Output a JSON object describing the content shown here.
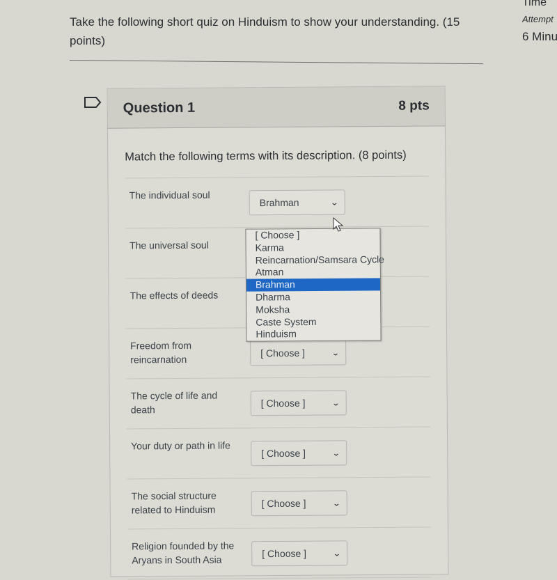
{
  "intro": {
    "text": "Take the following short quiz on Hinduism to show your understanding. (15 points)"
  },
  "side_panel": {
    "time_label": "Time",
    "attempt_label": "Attempt",
    "minutes_label": "6 Minu"
  },
  "question": {
    "flag_icon": "flag-question-icon",
    "title": "Question 1",
    "points": "8 pts",
    "prompt": "Match the following terms with its description. (8 points)",
    "rows": [
      {
        "label": "The individual soul",
        "selected": "Brahman",
        "open": true
      },
      {
        "label": "The universal soul",
        "selected": "[ Choose ]",
        "open": false
      },
      {
        "label": "The effects of deeds",
        "selected": "[ Choose ]",
        "open": false
      },
      {
        "label": "Freedom from reincarnation",
        "selected": "[ Choose ]",
        "open": false
      },
      {
        "label": "The cycle of life and death",
        "selected": "[ Choose ]",
        "open": false
      },
      {
        "label": "Your duty or path in life",
        "selected": "[ Choose ]",
        "open": false
      },
      {
        "label": "The social structure related to Hinduism",
        "selected": "[ Choose ]",
        "open": false
      },
      {
        "label": "Religion founded by the Aryans in South Asia",
        "selected": "[ Choose ]",
        "open": false
      }
    ],
    "dropdown_options": [
      "[ Choose ]",
      "Karma",
      "Reincarnation/Samsara Cycle",
      "Atman",
      "Brahman",
      "Dharma",
      "Moksha",
      "Caste System",
      "Hinduism"
    ],
    "highlighted_option": "Brahman"
  },
  "colors": {
    "highlight": "#1f67c4"
  }
}
